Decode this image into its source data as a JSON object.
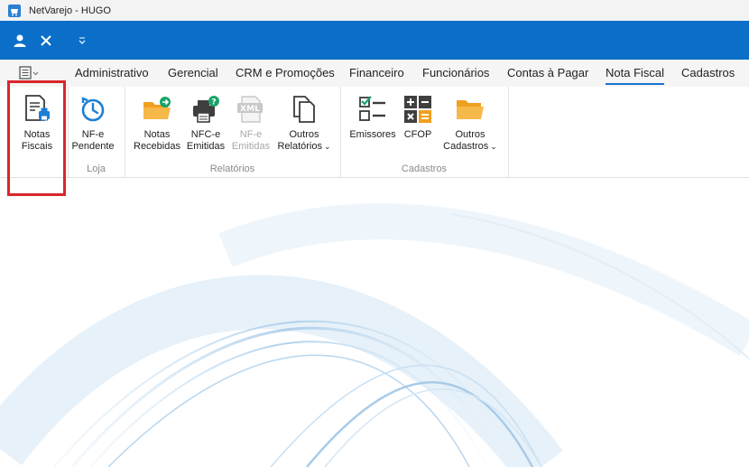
{
  "window": {
    "title": "NetVarejo - HUGO"
  },
  "quick_access": {
    "user_icon": "user-icon",
    "close_icon": "close-icon",
    "dropdown_icon": "chevron-down-icon"
  },
  "tabs": [
    {
      "label": "Administrativo"
    },
    {
      "label": "Gerencial"
    },
    {
      "label": "CRM e Promoções"
    },
    {
      "label": "Financeiro"
    },
    {
      "label": "Funcionários"
    },
    {
      "label": "Contas à Pagar"
    },
    {
      "label": "Nota Fiscal",
      "active": true
    },
    {
      "label": "Cadastros"
    }
  ],
  "ribbon": {
    "groups": [
      {
        "label": "",
        "buttons": [
          {
            "line1": "Notas",
            "line2": "Fiscais"
          }
        ]
      },
      {
        "label": "Loja",
        "buttons": [
          {
            "line1": "NF-e",
            "line2": "Pendente"
          }
        ]
      },
      {
        "label": "Relatórios",
        "buttons": [
          {
            "line1": "Notas",
            "line2": "Recebidas"
          },
          {
            "line1": "NFC-e",
            "line2": "Emitidas"
          },
          {
            "line1": "NF-e",
            "line2": "Emitidas",
            "disabled": true,
            "icon_text": "XML"
          },
          {
            "line1": "Outros",
            "line2": "Relatórios"
          }
        ]
      },
      {
        "label": "Cadastros",
        "buttons": [
          {
            "line1": "Emissores",
            "line2": ""
          },
          {
            "line1": "CFOP",
            "line2": ""
          },
          {
            "line1": "Outros",
            "line2": "Cadastros"
          }
        ]
      }
    ]
  },
  "colors": {
    "accent": "#0b6fc9",
    "tab_underline": "#1a73d1",
    "highlight": "#d9262c",
    "folder": "#f5a623"
  }
}
